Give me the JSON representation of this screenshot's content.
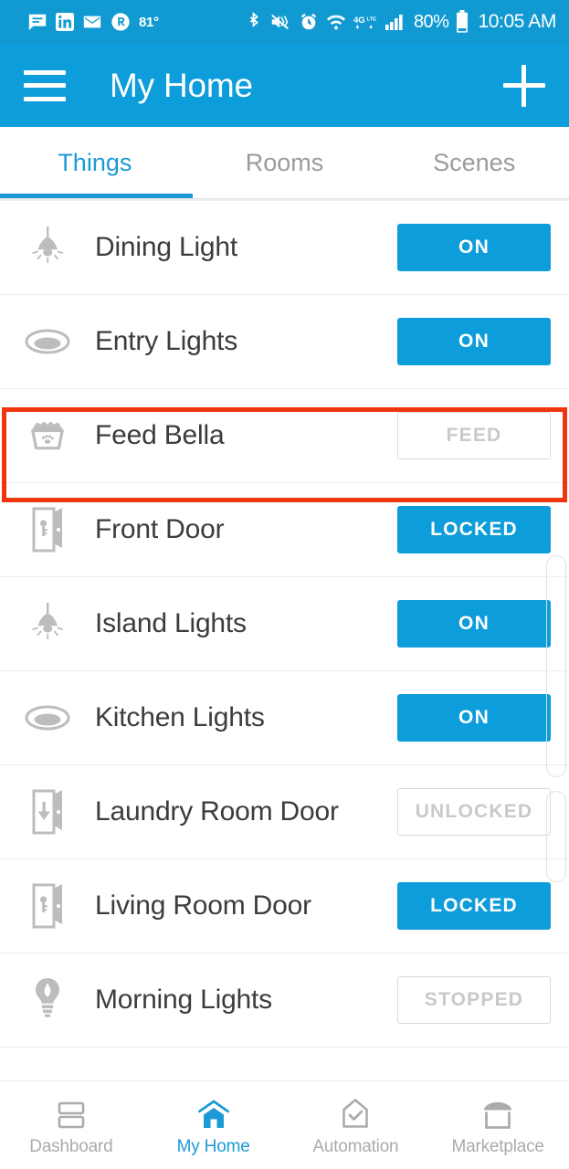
{
  "statusbar": {
    "icons_left": [
      "message-icon",
      "linkedin-icon",
      "email-icon",
      "circle-r-icon"
    ],
    "temperature": "81°",
    "icons_right": [
      "bluetooth-icon",
      "vibrate-mute-icon",
      "alarm-icon",
      "wifi-icon",
      "4g-lte-icon",
      "signal-bars-icon"
    ],
    "battery": "80%",
    "battery_icon": "battery-icon",
    "clock": "10:05 AM"
  },
  "appbar": {
    "menu_icon": "hamburger-menu-icon",
    "title": "My Home",
    "add_icon": "plus-icon"
  },
  "tabs": [
    {
      "label": "Things",
      "active": true
    },
    {
      "label": "Rooms",
      "active": false
    },
    {
      "label": "Scenes",
      "active": false
    }
  ],
  "things": [
    {
      "name": "Dining Light",
      "icon": "pendant-light-icon",
      "state": "ON",
      "on": true
    },
    {
      "name": "Entry Lights",
      "icon": "recessed-light-icon",
      "state": "ON",
      "on": true
    },
    {
      "name": "Feed Bella",
      "icon": "pet-bowl-icon",
      "state": "FEED",
      "on": false,
      "highlighted": true
    },
    {
      "name": "Front Door",
      "icon": "door-locked-icon",
      "state": "LOCKED",
      "on": true
    },
    {
      "name": "Island Lights",
      "icon": "pendant-light-icon",
      "state": "ON",
      "on": true
    },
    {
      "name": "Kitchen Lights",
      "icon": "recessed-light-icon",
      "state": "ON",
      "on": true
    },
    {
      "name": "Laundry Room Door",
      "icon": "door-unlocked-icon",
      "state": "UNLOCKED",
      "on": false
    },
    {
      "name": "Living Room Door",
      "icon": "door-locked-icon",
      "state": "LOCKED",
      "on": true
    },
    {
      "name": "Morning Lights",
      "icon": "bulb-icon",
      "state": "STOPPED",
      "on": false
    }
  ],
  "bottomnav": [
    {
      "label": "Dashboard",
      "icon": "dashboard-icon",
      "active": false
    },
    {
      "label": "My Home",
      "icon": "home-icon",
      "active": true
    },
    {
      "label": "Automation",
      "icon": "automation-icon",
      "active": false
    },
    {
      "label": "Marketplace",
      "icon": "marketplace-icon",
      "active": false
    }
  ],
  "colors": {
    "accent": "#0D9DDB",
    "statusbar": "#119AD2",
    "highlight": "#F0340E",
    "icon_grey": "#BDBDBD",
    "label_grey": "#9B9B9B"
  }
}
